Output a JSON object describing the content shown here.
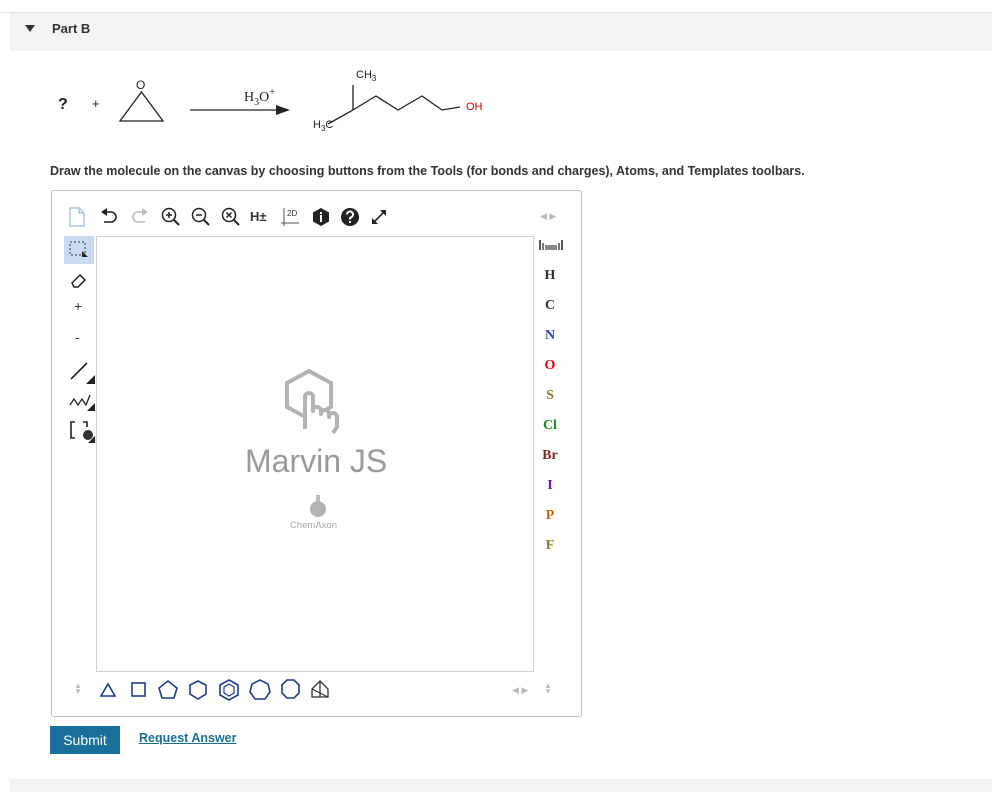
{
  "part": {
    "title": "Part B"
  },
  "reaction": {
    "unknown": "?",
    "plus": "+",
    "epoxide_o": "O",
    "reagent_main": "H",
    "reagent_sub": "3",
    "reagent_o": "O",
    "reagent_sup": "+",
    "product_ch3_main": "CH",
    "product_ch3_sub": "3",
    "product_h3c_main": "H",
    "product_h3c_sub": "3",
    "product_h3c_c": "C",
    "product_oh": "OH"
  },
  "instructions": "Draw the molecule on the canvas by choosing buttons from the Tools (for bonds and charges), Atoms, and Templates toolbars.",
  "editor": {
    "top_toolbar": {
      "hydrogen_label": "H±",
      "clean2d_label": "2D"
    },
    "left_toolbar": {
      "plus_label": "+",
      "minus_label": "-"
    },
    "atoms": [
      {
        "symbol": "H",
        "color": "#333333"
      },
      {
        "symbol": "C",
        "color": "#333333"
      },
      {
        "symbol": "N",
        "color": "#2a3fb0"
      },
      {
        "symbol": "O",
        "color": "#e00000"
      },
      {
        "symbol": "S",
        "color": "#8a7a1a"
      },
      {
        "symbol": "Cl",
        "color": "#1a8a1a"
      },
      {
        "symbol": "Br",
        "color": "#7a2a2a"
      },
      {
        "symbol": "I",
        "color": "#6a1a9a"
      },
      {
        "symbol": "P",
        "color": "#c06a00"
      },
      {
        "symbol": "F",
        "color": "#8a7a1a"
      }
    ],
    "watermark": {
      "title": "Marvin JS",
      "subtitle": "ChemAxon"
    }
  },
  "actions": {
    "submit_label": "Submit",
    "request_answer_label": "Request Answer"
  },
  "colors": {
    "accent": "#1a6f9a",
    "template_blue": "#1f3b8a"
  }
}
